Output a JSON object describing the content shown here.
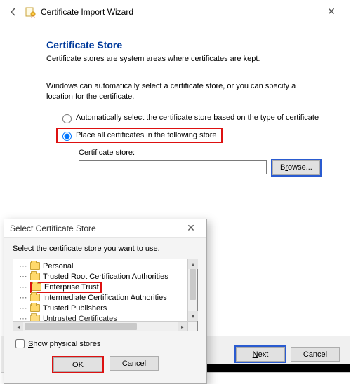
{
  "window": {
    "title": "Certificate Import Wizard",
    "heading": "Certificate Store",
    "sub": "Certificate stores are system areas where certificates are kept.",
    "para": "Windows can automatically select a certificate store, or you can specify a location for the certificate.",
    "radio_auto": "Automatically select the certificate store based on the type of certificate",
    "radio_place_pre": "Place all certificates in the following store",
    "store_label": "Certificate store:",
    "store_value": "",
    "browse": "Browse...",
    "next_pre": "N",
    "next_mid": "ext",
    "cancel": "Cancel"
  },
  "dialog": {
    "title": "Select Certificate Store",
    "instr": "Select the certificate store you want to use.",
    "items": {
      "personal": "Personal",
      "trcra": "Trusted Root Certification Authorities",
      "ent": "Enterprise Trust",
      "ica": "Intermediate Certification Authorities",
      "tp": "Trusted Publishers",
      "uc": "Untrusted Certificates"
    },
    "show_physical": "Show physical stores",
    "ok": "OK",
    "cancel": "Cancel"
  }
}
